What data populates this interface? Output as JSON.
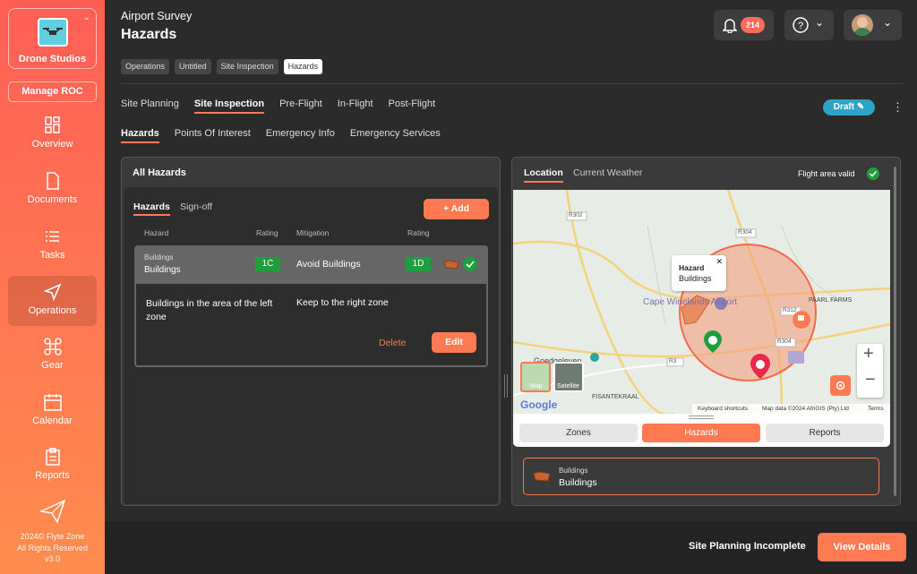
{
  "brand": {
    "name": "Drone Studios",
    "manage_label": "Manage ROC"
  },
  "nav": [
    {
      "label": "Overview",
      "icon": "overview-icon"
    },
    {
      "label": "Documents",
      "icon": "document-icon"
    },
    {
      "label": "Tasks",
      "icon": "tasks-icon"
    },
    {
      "label": "Operations",
      "icon": "send-icon",
      "active": true
    },
    {
      "label": "Gear",
      "icon": "drone-icon"
    },
    {
      "label": "Calendar",
      "icon": "calendar-icon"
    },
    {
      "label": "Reports",
      "icon": "clipboard-icon"
    }
  ],
  "footer": {
    "line1": "2024© Flyte Zone",
    "line2": "All Rights Reserved",
    "version": "v3.0"
  },
  "header": {
    "subtitle": "Airport Survey",
    "title": "Hazards",
    "notifications": "214"
  },
  "breadcrumbs": [
    "Operations",
    "Untitled",
    "Site Inspection",
    "Hazards"
  ],
  "tabs_primary": [
    "Site Planning",
    "Site Inspection",
    "Pre-Flight",
    "In-Flight",
    "Post-Flight"
  ],
  "tabs_secondary": [
    "Hazards",
    "Points Of Interest",
    "Emergency Info",
    "Emergency Services"
  ],
  "draft_label": "Draft",
  "hazards_panel": {
    "title": "All Hazards",
    "tabs": [
      "Hazards",
      "Sign-off"
    ],
    "add_label": "+ Add",
    "columns": [
      "Hazard",
      "Rating",
      "Mitigation",
      "Rating"
    ],
    "row": {
      "category": "Buildings",
      "hazard": "Buildings",
      "rating_before": "1C",
      "mitigation": "Avoid Buildings",
      "rating_after": "1D"
    },
    "detail": {
      "description": "Buildings in the area of the left zone",
      "mitigation": "Keep to the right zone",
      "delete_label": "Delete",
      "edit_label": "Edit"
    }
  },
  "map_panel": {
    "tabs": [
      "Location",
      "Current Weather"
    ],
    "status": "Flight area valid",
    "popup_title": "Hazard",
    "popup_text": "Buildings",
    "labels": {
      "airport": "Cape Winelands Airport",
      "farms": "PAARL FARMS",
      "goed": "Goedgeleven",
      "fisan": "FISANTEKRAAL",
      "r302": "R302",
      "r304": "R304",
      "r312": "R312",
      "r304b": "R304",
      "r3": "R3"
    },
    "layer_map": "Map",
    "layer_satellite": "Satellite",
    "attribution": [
      "Keyboard shortcuts",
      "Map data ©2024 AfriGIS (Pty) Ltd",
      "Terms"
    ],
    "google": "Google",
    "buttons": [
      "Zones",
      "Hazards",
      "Reports"
    ],
    "list_item": {
      "category": "Buildings",
      "name": "Buildings"
    }
  },
  "bottom": {
    "status": "Site Planning Incomplete",
    "view_details": "View Details"
  },
  "colors": {
    "accent": "#ff7a52",
    "teal": "#2da3c7",
    "green": "#1e9e3c"
  }
}
